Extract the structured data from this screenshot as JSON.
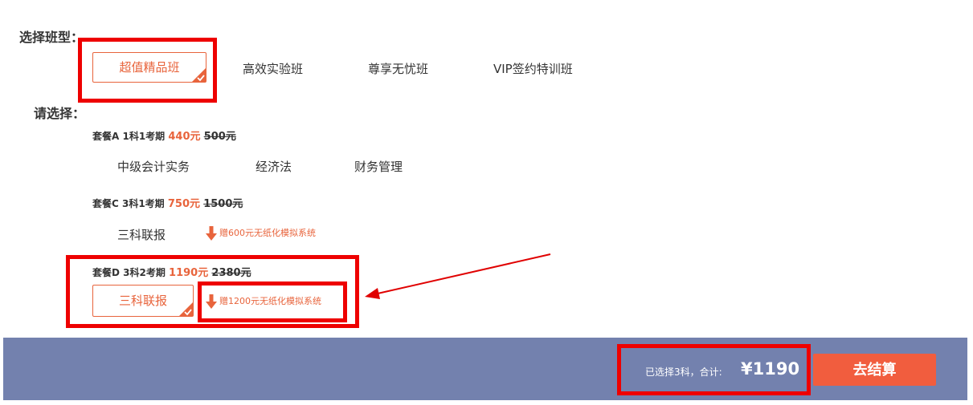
{
  "class_type": {
    "label": "选择班型：",
    "options": [
      "超值精品班",
      "高效实验班",
      "尊享无忧班",
      "VIP签约特训班"
    ]
  },
  "choose": {
    "label": "请选择：",
    "packages": [
      {
        "name": "套餐A 1科1考期",
        "price": "440元",
        "original": "500元",
        "subjects": [
          "中级会计实务",
          "经济法",
          "财务管理"
        ]
      },
      {
        "name": "套餐C 3科1考期",
        "price": "750元",
        "original": "1500元",
        "subjects": [
          "三科联报"
        ],
        "gift": "赠600元无纸化模拟系统"
      },
      {
        "name": "套餐D 3科2考期",
        "price": "1190元",
        "original": "2380元",
        "subjects": [
          "三科联报"
        ],
        "gift": "赠1200元无纸化模拟系统"
      }
    ]
  },
  "footer": {
    "selected_text": "已选择3科，合计:",
    "total": "¥1190",
    "checkout_label": "去结算"
  },
  "colors": {
    "accent": "#e8643c",
    "highlight_box": "#ee0000",
    "bar": "#7381ae",
    "checkout_button": "#f15d3e"
  }
}
